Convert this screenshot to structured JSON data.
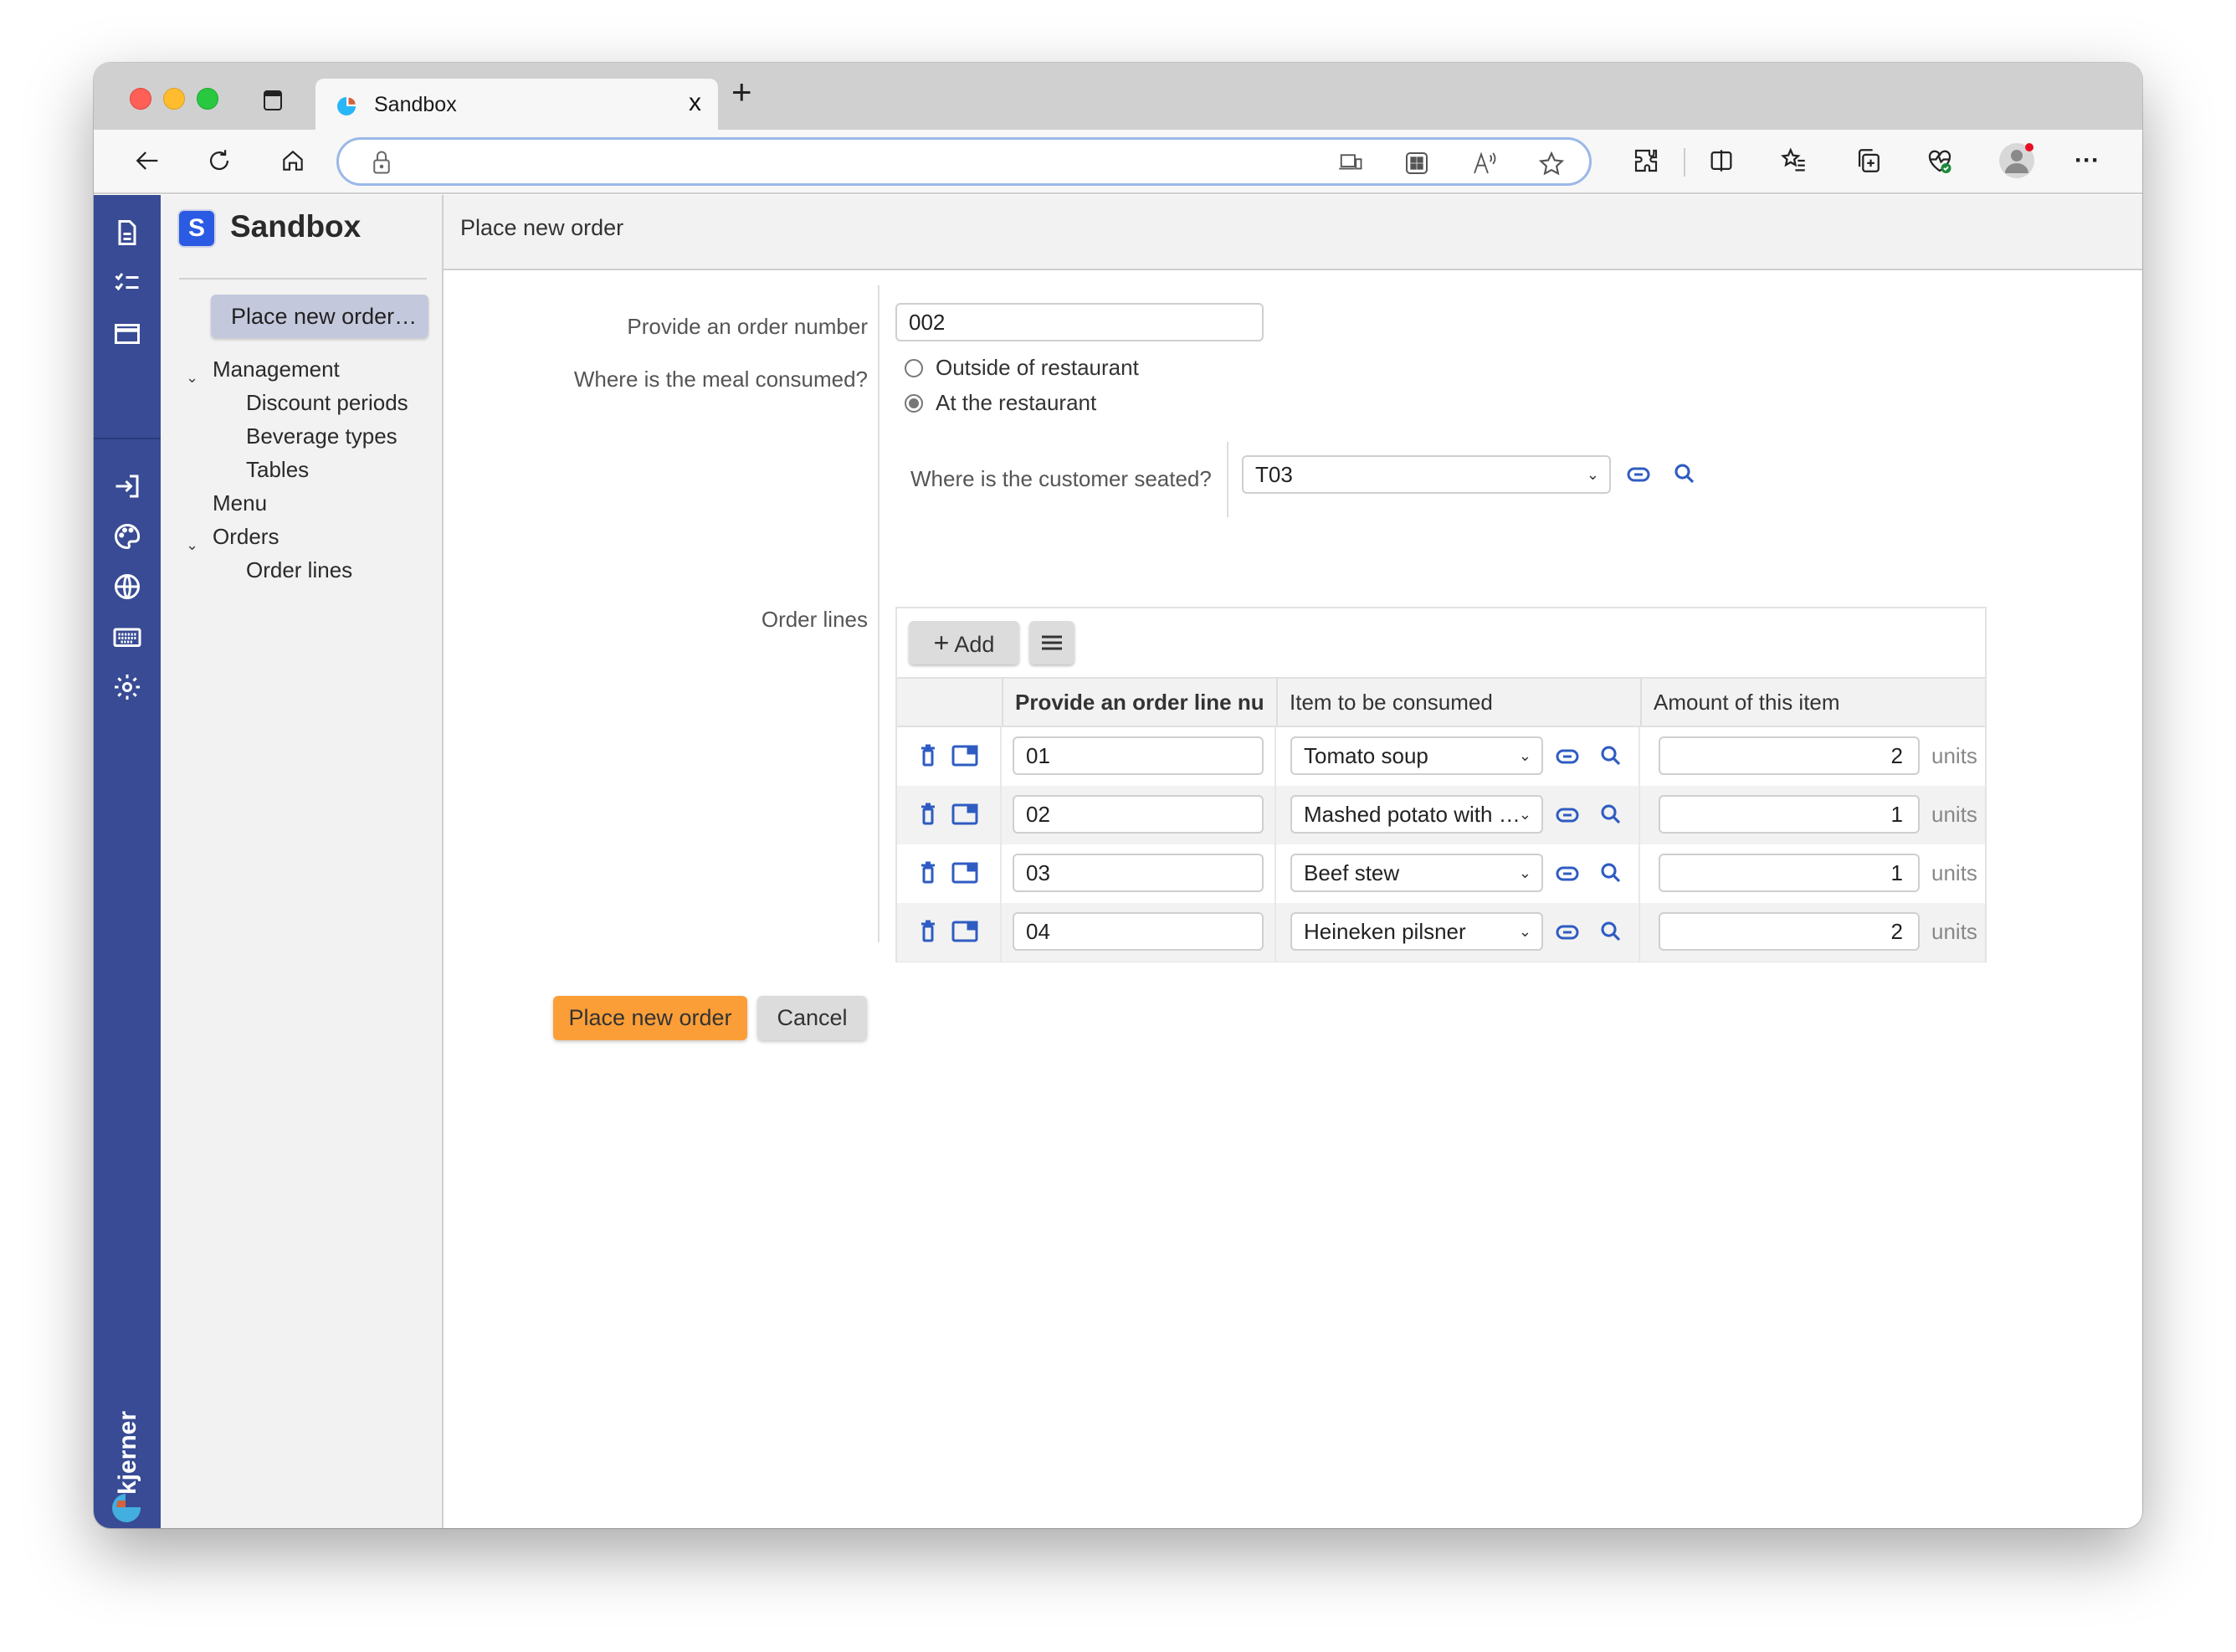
{
  "browser": {
    "tab_title": "Sandbox",
    "tab_close": "x",
    "new_tab": "+",
    "more": "···",
    "address": ""
  },
  "rail": {
    "brand": "kjerner",
    "icons": [
      "document-icon",
      "checklist-icon",
      "window-icon",
      "login-icon",
      "palette-icon",
      "globe-icon",
      "keyboard-icon",
      "gear-icon"
    ]
  },
  "nav": {
    "logo_letter": "S",
    "app_name": "Sandbox",
    "primary_action": "Place new order…",
    "items": [
      {
        "label": "Management",
        "expanded": true,
        "level": 0
      },
      {
        "label": "Discount periods",
        "level": 1
      },
      {
        "label": "Beverage types",
        "level": 1
      },
      {
        "label": "Tables",
        "level": 1
      },
      {
        "label": "Menu",
        "level": 0
      },
      {
        "label": "Orders",
        "expanded": true,
        "level": 0
      },
      {
        "label": "Order lines",
        "level": 1
      }
    ]
  },
  "main": {
    "title": "Place new order",
    "order_number": {
      "label": "Provide an order number",
      "value": "002"
    },
    "consumption": {
      "label": "Where is the meal consumed?",
      "options": [
        {
          "label": "Outside of restaurant",
          "selected": false
        },
        {
          "label": "At the restaurant",
          "selected": true
        }
      ]
    },
    "seating": {
      "label": "Where is the customer seated?",
      "value": "T03"
    },
    "order_lines": {
      "label": "Order lines",
      "add_label": "Add",
      "add_icon": "+",
      "columns": [
        "Provide an order line nu",
        "Item to be consumed",
        "Amount of this item"
      ],
      "unit_label": "units",
      "rows": [
        {
          "line": "01",
          "item": "Tomato soup",
          "amount": "2"
        },
        {
          "line": "02",
          "item": "Mashed potato with …",
          "amount": "1"
        },
        {
          "line": "03",
          "item": "Beef stew",
          "amount": "1"
        },
        {
          "line": "04",
          "item": "Heineken pilsner",
          "amount": "2"
        }
      ]
    },
    "buttons": {
      "submit": "Place new order",
      "cancel": "Cancel"
    }
  },
  "colors": {
    "rail": "#384b94",
    "accent_button": "#fb9e37",
    "link_icon": "#2f5cc2",
    "logo": "#2b5ae3"
  }
}
